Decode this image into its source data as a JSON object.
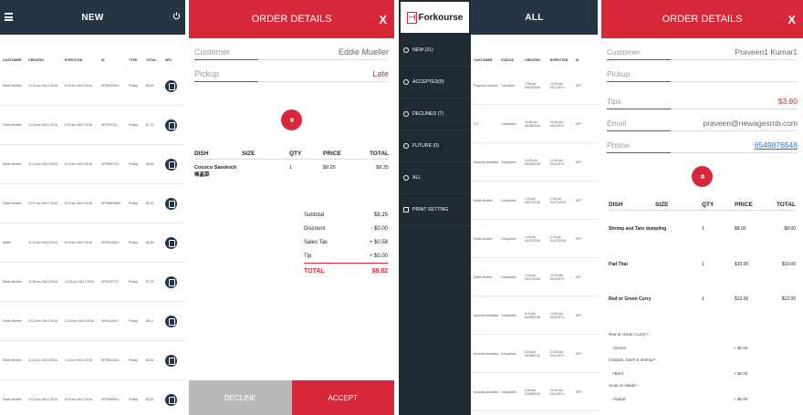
{
  "new_panel": {
    "title": "NEW",
    "columns": [
      "CUSTOMER",
      "CREATED",
      "EXPECTED",
      "ID",
      "TYPE",
      "TOTAL",
      "SPC"
    ],
    "rows": [
      [
        "Eddie Mueller",
        "12:20 am 06/17/2016",
        "8:00 am 06/17/2016",
        "#FF6520043",
        "Pickup",
        "$8.82"
      ],
      [
        "Eddie Mueller",
        "12:26 am 06/17/2016",
        "8:00 am 06/17/2016",
        "#FF652216",
        "Pickup",
        "$7.22"
      ],
      [
        "Eddie Mueller",
        "11:01 pm 06/17/2016",
        "8:00 am 06/17/2016",
        "#FF6522701",
        "Pickup",
        "$8.82"
      ],
      [
        "Eddie Mueller",
        "12:47 am 06/17/2016",
        "8:00 am 06/17/2016",
        "#FF65879850",
        "Pickup",
        "$8.82"
      ],
      [
        "dfdfdf",
        "11:14 am 06/17/2016",
        "8:00 am 06/17/2016",
        "#FF6216513",
        "Pickup",
        "$8.82"
      ],
      [
        "Eddie Mueller",
        "11:08 am 06/17/2016",
        "10:30 pm 06/17/2016",
        "#FF6207717",
        "Pickup",
        "$7.30"
      ],
      [
        "Eddie Mueller",
        "12:12 pm 06/17/2016",
        "12:15 pm 06/17/2016",
        "#FF6214407",
        "Pickup",
        "$8.14"
      ],
      [
        "Eddie Mueller",
        "11:13 pm 06/17/2016",
        "1:43 pm 06/17/2016",
        "#FF6519494",
        "Pickup",
        "$8.82"
      ],
      [
        "Eddie Mueller",
        "12:14 pm 06/17/2016",
        "8:00 am 06/17/2016",
        "#FF6500044",
        "Pickup",
        "$8.82"
      ]
    ]
  },
  "order1": {
    "title": "ORDER DETAILS",
    "close": "X",
    "customer_label": "Customer",
    "customer_value": "Eddie Mueller",
    "pickup_label": "Pickup",
    "pickup_value": "Late",
    "chevron": "»",
    "headers": {
      "dish": "DISH",
      "size": "SIZE",
      "qty": "QTY",
      "price": "PRICE",
      "total": "TOTAL"
    },
    "item": {
      "dish": "Cococo Sandeich",
      "dish2": "棒晶菜",
      "qty": "1",
      "price": "$8.25",
      "total": "$8.25"
    },
    "subtotal_label": "Subtotal",
    "subtotal": "$8.25",
    "discount_label": "Discount",
    "discount": "- $0.00",
    "tax_label": "Sales Tax",
    "tax": "+ $0.58",
    "tip_label": "Tip",
    "tip": "+ $0.00",
    "total_label": "TOTAL",
    "total": "$8.82",
    "decline": "DECLINE",
    "accept": "ACCEPT"
  },
  "menu": {
    "logo_text": "Forkourse",
    "items": [
      "NEW (21)",
      "ACCEPTED(0)",
      "DECLINED (7)",
      "FUTURE (0)",
      "ALL",
      "PRINT SETTING"
    ]
  },
  "all_panel": {
    "title": "ALL",
    "columns": [
      "CUSTOMER",
      "STATUS",
      "CREATED",
      "EXPECTED",
      "ID"
    ],
    "rows": [
      [
        "Praveen1 kumar1",
        "Cancelled",
        "2:35 pm 06/11/2016",
        "12:00 am 6/11/1973",
        "#FF"
      ],
      [
        "S S",
        "Completed",
        "11:46 am 06/08/2016",
        "12:00 am 6/11/1973",
        "#FF"
      ],
      [
        "Anamika Anamika",
        "Completed",
        "12:01 pm 06/18/2016",
        "12:00 am 6/11/1973",
        "#FF"
      ],
      [
        "Eddie Mueller",
        "Completed",
        "1:21 pm 04/17/2016",
        "2:00 pm 04/17/2016",
        "#FF"
      ],
      [
        "Eddie Mueller",
        "Completed",
        "1:16 pm 04/17/2016",
        "2:14 pm 04/17/2016",
        "#FF"
      ],
      [
        "Eddie Mueller",
        "Completed",
        "1:43 pm 04/17/2016",
        "12:00 am 6/11/1973",
        "#FF"
      ],
      [
        "Anamika Anamika",
        "Completed",
        "6:22 am 04/08/2016",
        "12:00 am 6/11/1973",
        "#FF"
      ],
      [
        "Anamika Anamika",
        "Completed",
        "6:18 am 04/08/2016",
        "12:00 am 6/11/1973",
        "#FF"
      ],
      [
        "Anamika Anamika",
        "Completed",
        "4:55 am 04/08/2016",
        "12:00 am 6/11/1973",
        "#FF"
      ]
    ]
  },
  "order2": {
    "title": "ORDER DETAILS",
    "close": "X",
    "customer_label": "Customer",
    "customer_value": "Praveen1 Kumar1",
    "pickup_label": "Pickup",
    "tips_label": "Tips",
    "tips_value": "$3.80",
    "email_label": "Email",
    "email_value": "praveen@newagesmb.com",
    "phone_label": "Phone",
    "phone_value": "6549876548",
    "chevron": "«",
    "headers": {
      "dish": "DISH",
      "size": "SIZE",
      "qty": "QTY",
      "price": "PRICE",
      "total": "TOTAL"
    },
    "items": [
      {
        "dish": "Shrimp and Taro dumpling",
        "qty": "1",
        "price": "$8.00",
        "total": "$8.00"
      },
      {
        "dish": "Pad Thai",
        "qty": "1",
        "price": "$10.00",
        "total": "$10.00"
      },
      {
        "dish": "Red or Green Curry",
        "qty": "1",
        "price": "$12.00",
        "total": "$12.00"
      }
    ],
    "options": [
      {
        "q": "Red or Green Curry? :",
        "a": ">Green",
        "p": "+ $0.00"
      },
      {
        "q": "Chicken, beef or shrimp? :",
        "a": ">Beef",
        "p": "+ $0.00"
      },
      {
        "q": "Soup or salad? :",
        "a": ">Salad",
        "p": "+ $0.00"
      }
    ]
  }
}
